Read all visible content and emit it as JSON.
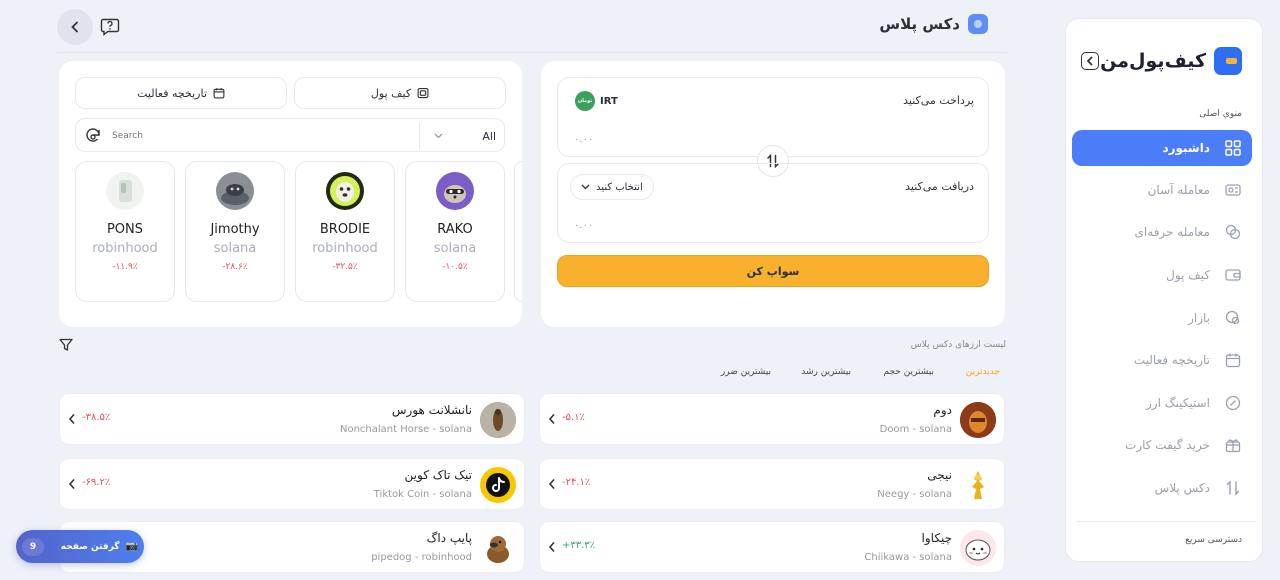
{
  "brand": {
    "name": "کیف‌پول‌من"
  },
  "sidebar": {
    "section_main": "منوی اصلی",
    "items": [
      {
        "label": "داشبورد",
        "icon": "grid-icon",
        "active": true
      },
      {
        "label": "معامله آسان",
        "icon": "easy-trade-icon"
      },
      {
        "label": "معامله حرفه‌ای",
        "icon": "pro-trade-icon"
      },
      {
        "label": "کیف پول",
        "icon": "wallet-icon"
      },
      {
        "label": "بازار",
        "icon": "market-icon"
      },
      {
        "label": "تاریخچه فعالیت",
        "icon": "calendar-icon"
      },
      {
        "label": "استیکینگ ارز",
        "icon": "staking-icon"
      },
      {
        "label": "خرید گیفت کارت",
        "icon": "gift-icon"
      },
      {
        "label": "دکس پلاس",
        "icon": "swap-arrows-icon"
      }
    ],
    "quick_access": "دسترسی سریع"
  },
  "header": {
    "title": "دکس پلاس"
  },
  "swap": {
    "pay_label": "پرداخت می‌کنید",
    "pay_token": "IRT",
    "pay_token_badge": "تومان",
    "pay_amount": "۰.۰۰",
    "receive_label": "دریافت می‌کنید",
    "receive_select": "انتخاب کنید",
    "receive_amount": "۰.۰۰",
    "swap_button": "سواپ کن"
  },
  "wallet_panel": {
    "tab_wallet": "کیف پول",
    "tab_history": "تاریخچه فعالیت",
    "filter_value": "All",
    "search_placeholder": "Search",
    "tokens": [
      {
        "name": "RAKO",
        "chain": "solana",
        "change": "-۱۰.۵٪"
      },
      {
        "name": "BRODIE",
        "chain": "robinhood",
        "change": "-۳۲.۵٪"
      },
      {
        "name": "Jimothy",
        "chain": "solana",
        "change": "-۲۸.۶٪"
      },
      {
        "name": "PONS",
        "chain": "robinhood",
        "change": "-۱۱.۹٪"
      }
    ]
  },
  "list": {
    "title": "لیست ارزهای دکس پلاس",
    "tabs": [
      "جدیدترین",
      "بیشترین حجم",
      "بیشترین رشد",
      "بیشترین ضرر"
    ],
    "right_column": [
      {
        "name": "دوم",
        "sub": "Doom - solana",
        "change": "-۵.۱٪",
        "trend": "neg"
      },
      {
        "name": "نیجی",
        "sub": "Neegy - solana",
        "change": "-۲۴.۱٪",
        "trend": "neg"
      },
      {
        "name": "چیکاوا",
        "sub": "Chiikawa - solana",
        "change": "+۳۳.۳٪",
        "trend": "pos"
      }
    ],
    "left_column": [
      {
        "name": "نانشلانت هورس",
        "sub": "Nonchalant Horse - solana",
        "change": "-۳۸.۵٪",
        "trend": "neg"
      },
      {
        "name": "تیک تاک کوین",
        "sub": "Tiktok Coin - solana",
        "change": "-۶۹.۲٪",
        "trend": "neg"
      },
      {
        "name": "پایپ داگ",
        "sub": "pipedog - robinhood",
        "change": "",
        "trend": "neg"
      }
    ]
  },
  "fab": {
    "label": "گرفتن صفحه",
    "count": "9"
  },
  "colors": {
    "accent": "#4a7df7",
    "swap_button": "#f9b02c",
    "negative": "#e0525a",
    "positive": "#2fa56b"
  }
}
